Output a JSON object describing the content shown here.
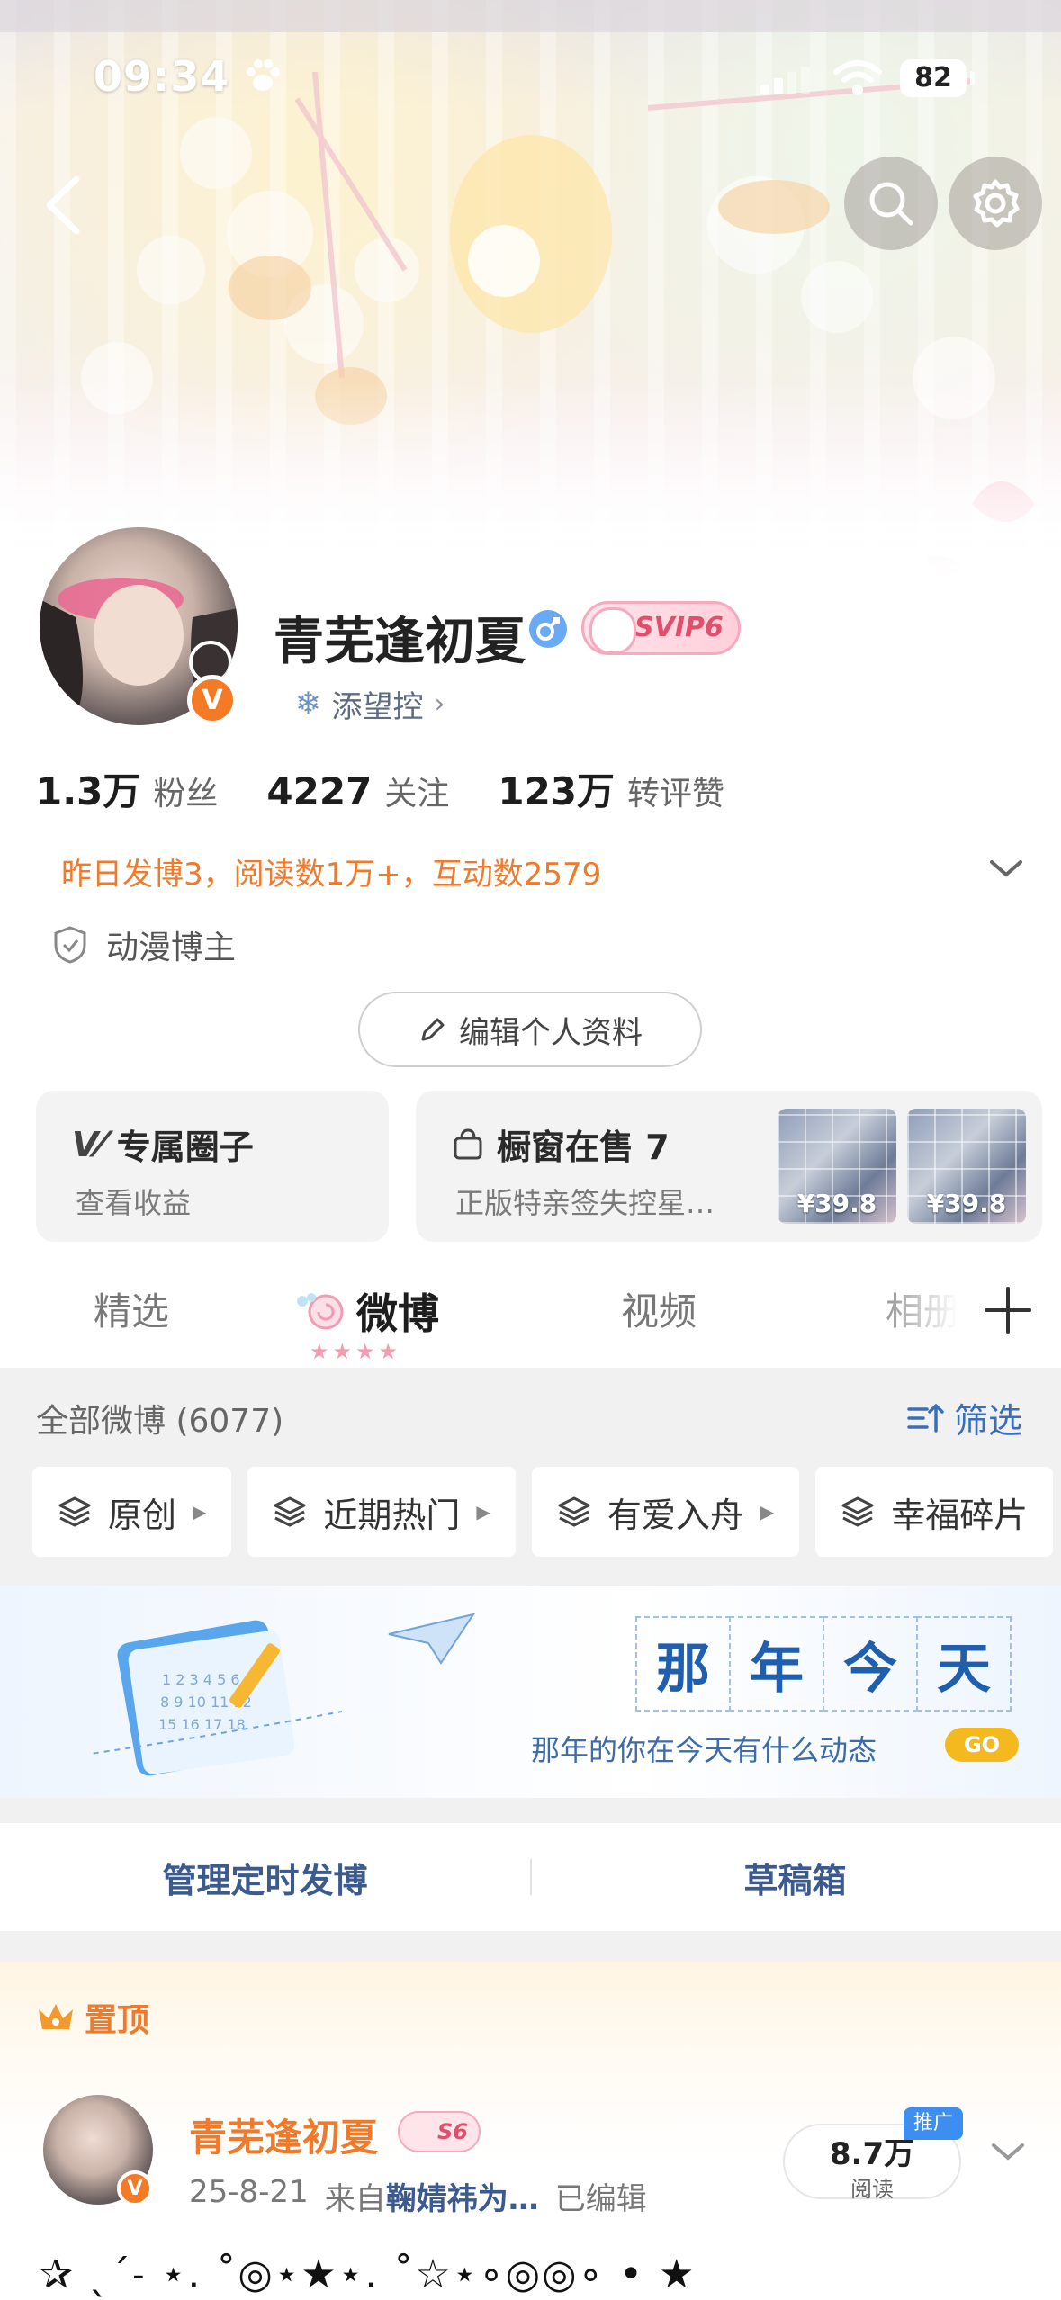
{
  "status_bar": {
    "time": "09:34",
    "battery": "82"
  },
  "profile": {
    "name": "青芜逢初夏",
    "svip": "SVIP6",
    "fan_group": "添望控",
    "stats": [
      {
        "value": "1.3万",
        "label": "粉丝"
      },
      {
        "value": "4227",
        "label": "关注"
      },
      {
        "value": "123万",
        "label": "转评赞"
      }
    ],
    "daily_summary": "昨日发博3，阅读数1万+，互动数2579",
    "tag": "动漫博主",
    "edit_label": "编辑个人资料"
  },
  "cards": {
    "circle": {
      "title": "专属圈子",
      "sub": "查看收益"
    },
    "shop": {
      "title": "橱窗在售 7",
      "sub": "正版特亲签失控星…",
      "prices": [
        "¥39.8",
        "¥39.8"
      ]
    }
  },
  "tabs": {
    "items": [
      "精选",
      "微博",
      "视频",
      "相册"
    ],
    "active": "微博"
  },
  "feed": {
    "header": "全部微博 (6077)",
    "filter_label": "筛选",
    "chips": [
      "原创",
      "近期热门",
      "有爱入舟",
      "幸福碎片"
    ],
    "memory": {
      "title_chars": [
        "那",
        "年",
        "今",
        "天"
      ],
      "subtitle": "那年的你在今天有什么动态",
      "go": "GO"
    },
    "manage": {
      "scheduled": "管理定时发博",
      "drafts": "草稿箱"
    },
    "pinned": {
      "label": "置顶",
      "author": "青芜逢初夏",
      "badge": "S6",
      "date": "25-8-21",
      "source_prefix": "来自",
      "source": "鞠婧祎为…",
      "edited": "已编辑",
      "reads_value": "8.7万",
      "reads_label": "阅读",
      "promo": "推广",
      "text": "✰ ˎˊ˗ ⋆. ˚◎⋆★⋆. ˚☆⋆∘◎◎∘ • ★"
    }
  },
  "colors": {
    "accent_orange": "#f07a2a",
    "link_blue": "#3b5a8e",
    "filter_blue": "#3a6fb7",
    "verified_orange": "#f57a26"
  }
}
